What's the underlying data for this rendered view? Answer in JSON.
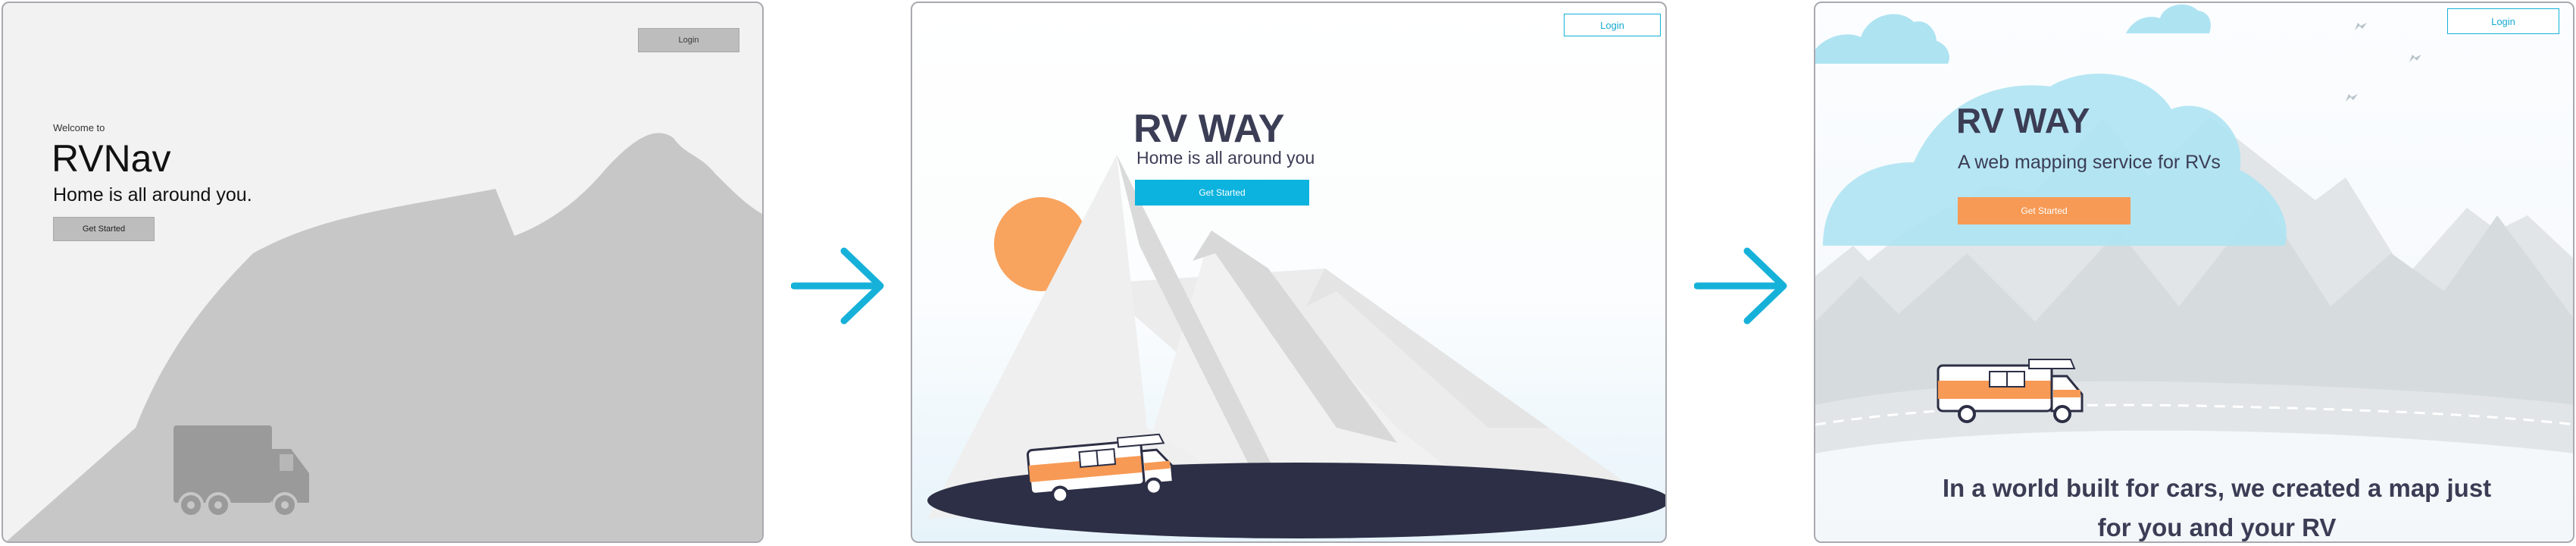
{
  "wireframe": {
    "login_label": "Login",
    "welcome": "Welcome to",
    "title": "RVNav",
    "tagline": "Home is all around you.",
    "cta_label": "Get Started"
  },
  "mockup_v2": {
    "login_label": "Login",
    "title": "RV WAY",
    "tagline": "Home is all around you",
    "cta_label": "Get Started",
    "cta_color": "#0bb3de"
  },
  "mockup_v3": {
    "login_label": "Login",
    "title": "RV WAY",
    "tagline": "A web mapping service for RVs",
    "cta_label": "Get Started",
    "cta_color": "#f79a55",
    "headline": "In a world built for cars, we created a map just for you and your RV"
  },
  "colors": {
    "accent_blue": "#17b0d8",
    "accent_orange": "#f79a55",
    "text_dark": "#3b3d55"
  }
}
